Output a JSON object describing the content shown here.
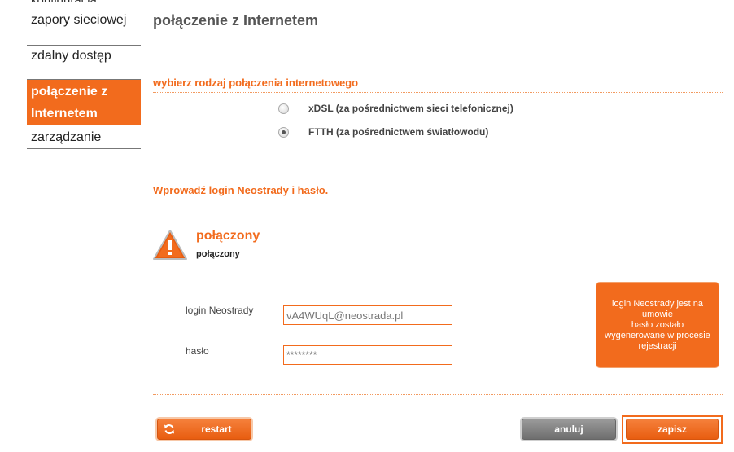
{
  "sidebar": {
    "partial_top_label": "konfiguracja",
    "items": [
      {
        "label": "zapory sieciowej"
      },
      {
        "label": "zdalny dostęp"
      },
      {
        "label_line1": "połączenie z",
        "label_line2": "Internetem"
      },
      {
        "label": "zarządzanie"
      }
    ]
  },
  "main": {
    "title": "połączenie z Internetem",
    "connection_type": {
      "heading": "wybierz rodzaj połączenia internetowego",
      "options": [
        {
          "label": "xDSL (za pośrednictwem sieci telefonicznej)",
          "selected": false
        },
        {
          "label": "FTTH (za pośrednictwem światłowodu)",
          "selected": true
        }
      ]
    },
    "credentials_heading": "Wprowadź login Neostrady i hasło.",
    "status": {
      "icon": "warning-triangle-icon",
      "title": "połączony",
      "subtitle": "połączony"
    },
    "form": {
      "login_label": "login Neostrady",
      "login_value": "vA4WUqL@neostrada.pl",
      "password_label": "hasło",
      "password_value": "********"
    },
    "info_box": {
      "line1": "login Neostrady jest na umowie",
      "line2": "hasło zostało wygenerowane w procesie rejestracji"
    }
  },
  "buttons": {
    "restart": "restart",
    "cancel": "anuluj",
    "save": "zapisz"
  },
  "colors": {
    "accent": "#f26b1d",
    "cancel_gray": "#7a7a7a"
  }
}
